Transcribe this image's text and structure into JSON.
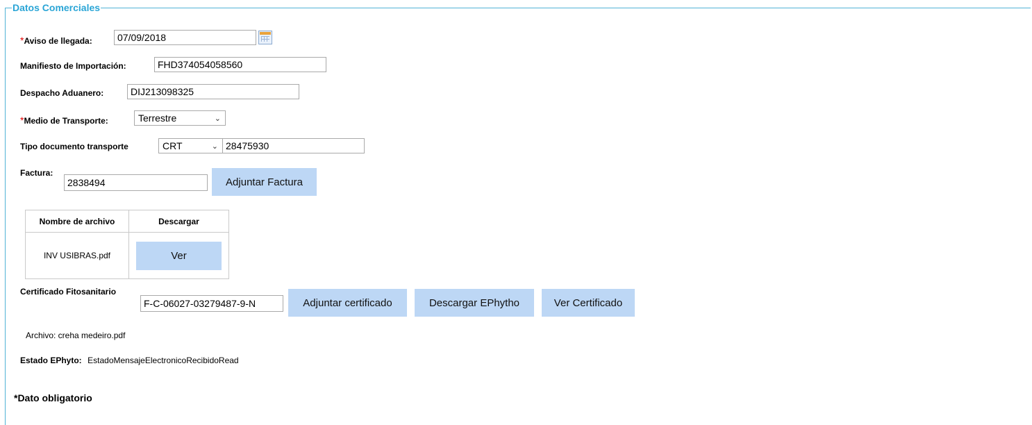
{
  "section": {
    "legend": "Datos Comerciales"
  },
  "aviso": {
    "required_mark": "*",
    "label": "Aviso de llegada:",
    "value": "07/09/2018"
  },
  "manifiesto": {
    "label": "Manifiesto de Importación:",
    "value": "FHD374054058560"
  },
  "despacho": {
    "label": "Despacho Aduanero:",
    "value": "DIJ213098325"
  },
  "medio": {
    "required_mark": "*",
    "label": "Medio de Transporte:",
    "selected": "Terrestre"
  },
  "tipo_doc": {
    "label": "Tipo documento transporte",
    "selected": "CRT",
    "number": "28475930"
  },
  "factura": {
    "label": "Factura:",
    "value": "2838494",
    "attach_button": "Adjuntar Factura"
  },
  "files_table": {
    "headers": [
      "Nombre de archivo",
      "Descargar"
    ],
    "rows": [
      {
        "name": "INV USIBRAS.pdf",
        "action": "Ver"
      }
    ]
  },
  "certificado": {
    "label": "Certificado Fitosanitario",
    "value": "F-C-06027-03279487-9-N",
    "attach_button": "Adjuntar certificado",
    "download_button": "Descargar EPhytho",
    "view_button": "Ver Certificado",
    "file_text": "Archivo: creha medeiro.pdf"
  },
  "estado": {
    "label": "Estado EPhyto:",
    "value": "EstadoMensajeElectronicoRecibidoRead"
  },
  "footer_note": "*Dato obligatorio"
}
